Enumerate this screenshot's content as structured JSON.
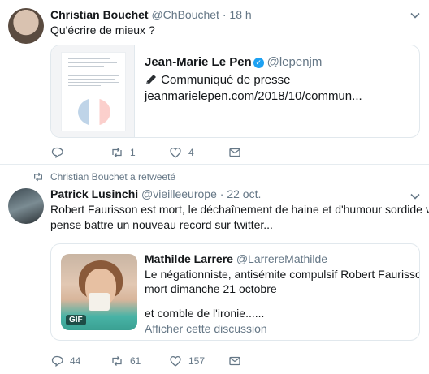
{
  "tweet1": {
    "name": "Christian Bouchet",
    "handle": "@ChBouchet",
    "separator": "·",
    "time": "18 h",
    "text": "Qu'écrire de mieux ?",
    "card": {
      "name": "Jean-Marie Le Pen",
      "handle": "@lepenjm",
      "line1": "Communiqué de presse",
      "link": "jeanmarielepen.com/2018/10/commun..."
    },
    "actions": {
      "reply": "",
      "retweet": "1",
      "like": "4"
    }
  },
  "tweet2": {
    "retweeted_by": "Christian Bouchet a retweeté",
    "name": "Patrick Lusinchi",
    "handle": "@vieilleeurope",
    "separator": "·",
    "time": "22 oct.",
    "text_line1": "Robert Faurisson est mort, le déchaînement de haine et d'humour sordide va je",
    "text_line2": "pense battre un nouveau record sur twitter...",
    "card": {
      "name": "Mathilde Larrere",
      "handle": "@LarrereMathilde",
      "line1": "Le négationniste, antisémite compulsif Robert Faurisson est",
      "line2": "mort dimanche 21 octobre",
      "line3": "et comble de l'ironie......",
      "link": "Afficher cette discussion",
      "badge": "GIF"
    },
    "actions": {
      "reply": "44",
      "retweet": "61",
      "like": "157"
    }
  },
  "colors": {
    "verified": "#1da1f2",
    "muted": "#657786",
    "text": "#14171a",
    "border": "#e6ecf0"
  }
}
